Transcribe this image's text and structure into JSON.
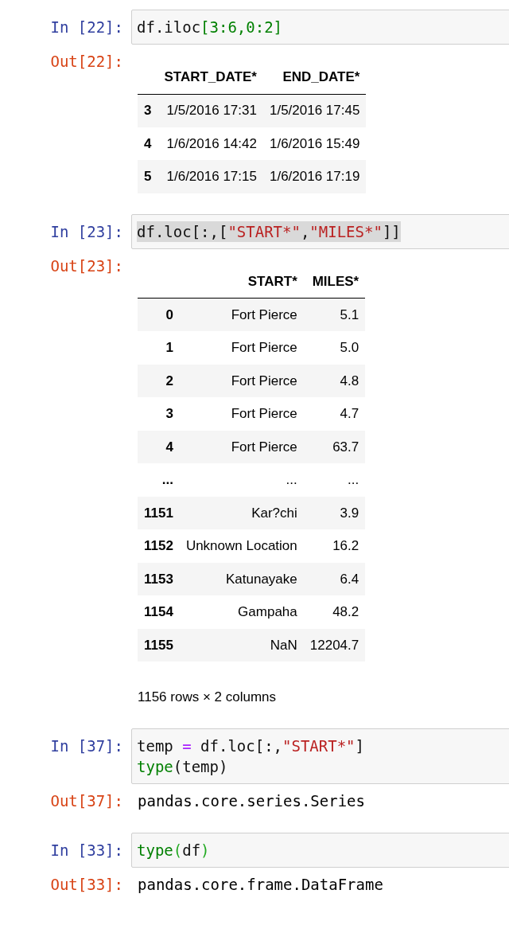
{
  "cells": [
    {
      "prompt_in": "In [22]:",
      "code": {
        "selected": false,
        "lines": [
          [
            {
              "kind": "plain",
              "text": "df.iloc"
            },
            {
              "kind": "number",
              "text": "[3:6,0:2]"
            }
          ]
        ]
      },
      "prompt_out": "Out[22]:",
      "output": {
        "kind": "table",
        "columns": [
          "START_DATE*",
          "END_DATE*"
        ],
        "rows": [
          {
            "index": "3",
            "cells": [
              "1/5/2016 17:31",
              "1/5/2016 17:45"
            ]
          },
          {
            "index": "4",
            "cells": [
              "1/6/2016 14:42",
              "1/6/2016 15:49"
            ]
          },
          {
            "index": "5",
            "cells": [
              "1/6/2016 17:15",
              "1/6/2016 17:19"
            ]
          }
        ]
      }
    },
    {
      "prompt_in": "In [23]:",
      "code": {
        "selected": true,
        "lines": [
          [
            {
              "kind": "plain",
              "text": "df.loc[:,["
            },
            {
              "kind": "string",
              "text": "\"START*\""
            },
            {
              "kind": "plain",
              "text": ","
            },
            {
              "kind": "string",
              "text": "\"MILES*\""
            },
            {
              "kind": "plain",
              "text": "]]"
            }
          ]
        ]
      },
      "prompt_out": "Out[23]:",
      "output": {
        "kind": "table",
        "columns": [
          "START*",
          "MILES*"
        ],
        "rows": [
          {
            "index": "0",
            "cells": [
              "Fort Pierce",
              "5.1"
            ]
          },
          {
            "index": "1",
            "cells": [
              "Fort Pierce",
              "5.0"
            ]
          },
          {
            "index": "2",
            "cells": [
              "Fort Pierce",
              "4.8"
            ]
          },
          {
            "index": "3",
            "cells": [
              "Fort Pierce",
              "4.7"
            ]
          },
          {
            "index": "4",
            "cells": [
              "Fort Pierce",
              "63.7"
            ]
          },
          {
            "index": "...",
            "cells": [
              "...",
              "..."
            ]
          },
          {
            "index": "1151",
            "cells": [
              "Kar?chi",
              "3.9"
            ]
          },
          {
            "index": "1152",
            "cells": [
              "Unknown Location",
              "16.2"
            ]
          },
          {
            "index": "1153",
            "cells": [
              "Katunayake",
              "6.4"
            ]
          },
          {
            "index": "1154",
            "cells": [
              "Gampaha",
              "48.2"
            ]
          },
          {
            "index": "1155",
            "cells": [
              "NaN",
              "12204.7"
            ]
          }
        ],
        "footer": "1156 rows × 2 columns"
      }
    },
    {
      "prompt_in": "In [37]:",
      "code": {
        "selected": false,
        "lines": [
          [
            {
              "kind": "plain",
              "text": "temp "
            },
            {
              "kind": "operator",
              "text": "="
            },
            {
              "kind": "plain",
              "text": " df.loc[:,"
            },
            {
              "kind": "string",
              "text": "\"START*\""
            },
            {
              "kind": "plain",
              "text": "]"
            }
          ],
          [
            {
              "kind": "builtin",
              "text": "type"
            },
            {
              "kind": "plain",
              "text": "(temp)"
            }
          ]
        ]
      },
      "prompt_out": "Out[37]:",
      "output": {
        "kind": "text",
        "text": "pandas.core.series.Series"
      }
    },
    {
      "prompt_in": "In [33]:",
      "code": {
        "selected": false,
        "lines": [
          [
            {
              "kind": "builtin",
              "text": "type"
            },
            {
              "kind": "match",
              "text": "("
            },
            {
              "kind": "plain",
              "text": "df"
            },
            {
              "kind": "match",
              "text": ")"
            }
          ]
        ]
      },
      "prompt_out": "Out[33]:",
      "output": {
        "kind": "text",
        "text": "pandas.core.frame.DataFrame"
      }
    }
  ]
}
